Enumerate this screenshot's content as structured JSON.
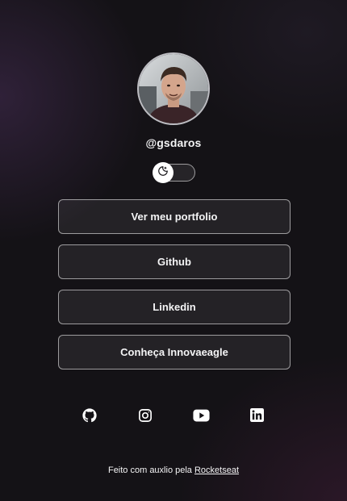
{
  "profile": {
    "username": "@gsdaros"
  },
  "theme_switch": {
    "icon": "moon-icon",
    "state": "dark"
  },
  "links": [
    {
      "label": "Ver meu portfolio"
    },
    {
      "label": "Github"
    },
    {
      "label": "Linkedin"
    },
    {
      "label": "Conheça Innovaeagle"
    }
  ],
  "socials": [
    {
      "icon": "github-icon"
    },
    {
      "icon": "instagram-icon"
    },
    {
      "icon": "youtube-icon"
    },
    {
      "icon": "linkedin-icon"
    }
  ],
  "footer": {
    "text": "Feito com auxlio pela",
    "link_label": "Rocketseat"
  },
  "colors": {
    "background": "#141216",
    "text": "#f4f4f5",
    "button_border": "#8e8e93"
  }
}
